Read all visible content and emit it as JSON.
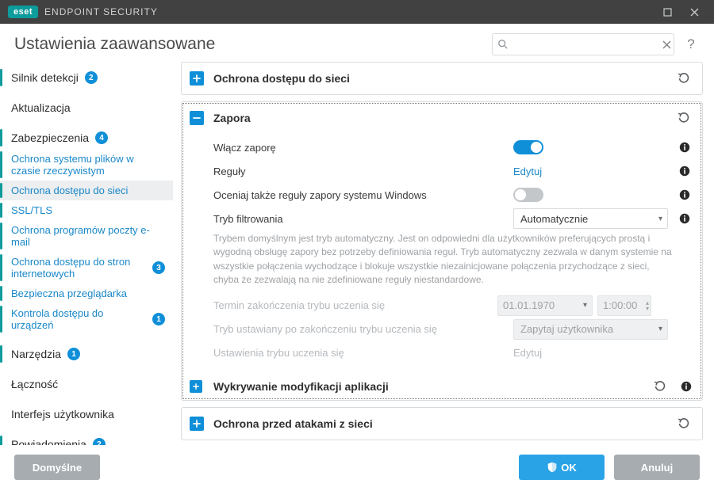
{
  "app": {
    "brand_badge": "eset",
    "brand_name": "ENDPOINT SECURITY"
  },
  "header": {
    "title": "Ustawienia zaawansowane",
    "search_placeholder": "",
    "help": "?"
  },
  "sidebar": {
    "items": [
      {
        "label": "Silnik detekcji",
        "badge": "2"
      },
      {
        "label": "Aktualizacja"
      },
      {
        "label": "Zabezpieczenia",
        "badge": "4"
      },
      {
        "label": "Ochrona systemu plików w czasie rzeczywistym"
      },
      {
        "label": "Ochrona dostępu do sieci"
      },
      {
        "label": "SSL/TLS"
      },
      {
        "label": "Ochrona programów poczty e-mail"
      },
      {
        "label": "Ochrona dostępu do stron internetowych",
        "badge": "3"
      },
      {
        "label": "Bezpieczna przeglądarka"
      },
      {
        "label": "Kontrola dostępu do urządzeń",
        "badge": "1"
      },
      {
        "label": "Narzędzia",
        "badge": "1"
      },
      {
        "label": "Łączność"
      },
      {
        "label": "Interfejs użytkownika"
      },
      {
        "label": "Powiadomienia",
        "badge": "2"
      }
    ]
  },
  "panels": {
    "network_access": {
      "title": "Ochrona dostępu do sieci"
    },
    "firewall": {
      "title": "Zapora",
      "enable_label": "Włącz zaporę",
      "rules_label": "Reguły",
      "rules_action": "Edytuj",
      "eval_windows_label": "Oceniaj także reguły zapory systemu Windows",
      "filter_mode_label": "Tryb filtrowania",
      "filter_mode_value": "Automatycznie",
      "filter_mode_desc": "Trybem domyślnym jest tryb automatyczny. Jest on odpowiedni dla użytkowników preferujących prostą i wygodną obsługę zapory bez potrzeby definiowania reguł. Tryb automatyczny zezwala w danym systemie na wszystkie połączenia wychodzące i blokuje wszystkie niezainicjowane połączenia przychodzące z sieci, chyba że zezwalają na nie zdefiniowane reguły niestandardowe.",
      "learn_end_label": "Termin zakończenia trybu uczenia się",
      "learn_end_date": "01.01.1970",
      "learn_end_time": "1:00:00",
      "after_learn_label": "Tryb ustawiany po zakończeniu trybu uczenia się",
      "after_learn_value": "Zapytaj użytkownika",
      "learn_settings_label": "Ustawienia trybu uczenia się",
      "learn_settings_action": "Edytuj",
      "app_mod_title": "Wykrywanie modyfikacji aplikacji"
    },
    "network_attack": {
      "title": "Ochrona przed atakami z sieci"
    }
  },
  "footer": {
    "defaults": "Domyślne",
    "ok": "OK",
    "cancel": "Anuluj"
  }
}
